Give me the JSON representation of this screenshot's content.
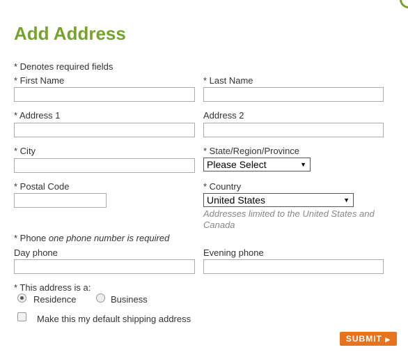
{
  "title": "Add Address",
  "required_note": "* Denotes required fields",
  "fields": {
    "first_name": {
      "label": "* First Name",
      "value": ""
    },
    "last_name": {
      "label": "* Last Name",
      "value": ""
    },
    "address1": {
      "label": "* Address 1",
      "value": ""
    },
    "address2": {
      "label": "Address 2",
      "value": ""
    },
    "city": {
      "label": "* City",
      "value": ""
    },
    "state": {
      "label": "* State/Region/Province",
      "value": "Please Select"
    },
    "postal": {
      "label": "* Postal Code",
      "value": ""
    },
    "country": {
      "label": "* Country",
      "value": "United States",
      "note": "Addresses limited to the United States and Canada"
    },
    "phone": {
      "label": "* Phone",
      "note": "one phone number is required"
    },
    "day_phone": {
      "label": "Day phone",
      "value": ""
    },
    "evening_phone": {
      "label": "Evening phone",
      "value": ""
    }
  },
  "address_type": {
    "label": "* This address is a:",
    "options": [
      "Residence",
      "Business"
    ],
    "selected": "Residence"
  },
  "default_shipping": {
    "label": "Make this my default shipping address",
    "checked": false
  },
  "submit": {
    "label": "SUBMIT",
    "icon": "play-arrow-icon"
  },
  "colors": {
    "title": "#76a22e",
    "submit": "#e8731e"
  }
}
